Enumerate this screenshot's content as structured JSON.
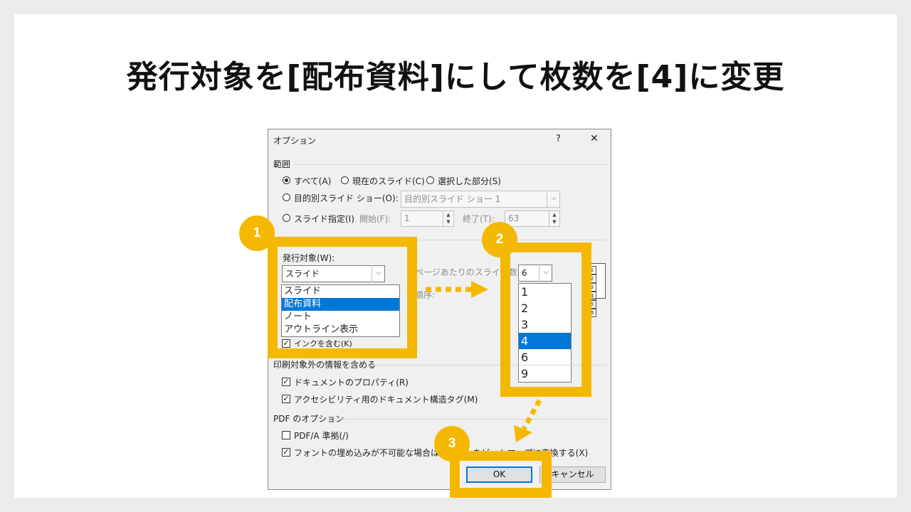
{
  "page": {
    "heading": "発行対象を[配布資料]にして枚数を[4]に変更"
  },
  "dialog": {
    "title": "オプション",
    "help_label": "?",
    "close_label": "✕",
    "range": {
      "group_label": "範囲",
      "all_label": "すべて(A)",
      "current_slide_label": "現在のスライド(C)",
      "selection_label": "選択した部分(S)",
      "custom_show_label": "目的別スライド ショー(O):",
      "custom_show_value": "目的別スライド ショー 1",
      "slides_label": "スライド指定(I)",
      "from_label": "開始(F):",
      "from_value": "1",
      "to_label": "終了(T):",
      "to_value": "63"
    },
    "publish": {
      "label": "発行対象(W):",
      "value": "スライド",
      "options": [
        "スライド",
        "配布資料",
        "ノート",
        "アウトライン表示"
      ],
      "selected": "配布資料",
      "ink_label": "インクを含む(K)"
    },
    "handout": {
      "per_page_label": "ページあたりのスライド数(L):",
      "per_page_value": "6",
      "per_page_options": [
        "1",
        "2",
        "3",
        "4",
        "6",
        "9"
      ],
      "selected": "4",
      "order_label": "順序:",
      "layout_glyphs": [
        "1",
        "2",
        "3",
        "4",
        "5",
        "6"
      ]
    },
    "nonprint": {
      "group_label": "印刷対象外の情報を含める",
      "doc_props_label": "ドキュメントのプロパティ(R)",
      "access_tags_label": "アクセシビリティ用のドキュメント構造タグ(M)"
    },
    "pdf": {
      "group_label": "PDF のオプション",
      "pdfa_label": "PDF/A 準拠(/)",
      "bitmap_label": "フォントの埋め込みが不可能な場合はテキストをビットマップに変換する(X)"
    },
    "buttons": {
      "ok": "OK",
      "cancel": "キャンセル"
    }
  },
  "annotations": {
    "step1": "1",
    "step2": "2",
    "step3": "3",
    "accent_color": "#f5b800"
  }
}
